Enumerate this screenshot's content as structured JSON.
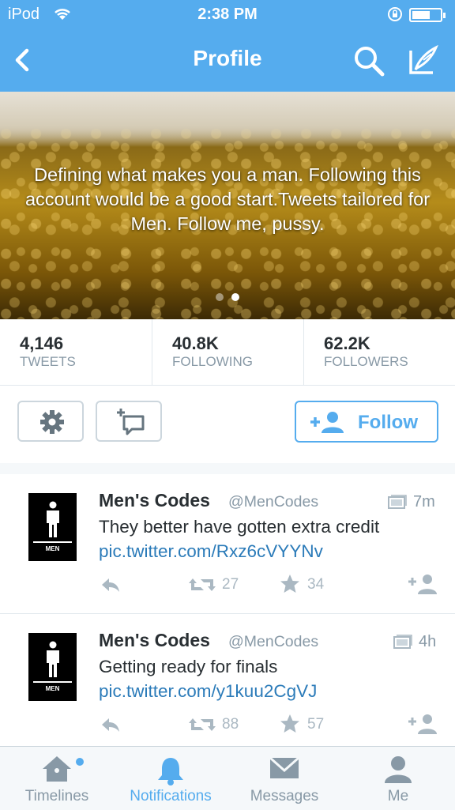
{
  "status_bar": {
    "carrier": "iPod",
    "time": "2:38 PM"
  },
  "nav": {
    "title": "Profile",
    "back_icon": "chevron-left-icon",
    "search_icon": "search-icon",
    "compose_icon": "compose-icon"
  },
  "banner": {
    "bio": "Defining what makes you a man. Following this account would be a good start.Tweets tailored for Men. Follow me, pussy.",
    "page_count": 2,
    "active_page": 2
  },
  "stats": [
    {
      "value": "4,146",
      "label": "TWEETS"
    },
    {
      "value": "40.8K",
      "label": "FOLLOWING"
    },
    {
      "value": "62.2K",
      "label": "FOLLOWERS"
    }
  ],
  "actions": {
    "settings_icon": "gear-icon",
    "list_icon": "add-to-list-icon",
    "follow_label": "Follow"
  },
  "tweets": [
    {
      "name": "Men's Codes",
      "handle": "@MenCodes",
      "time": "7m",
      "text": "They better have gotten extra credit",
      "link": "pic.twitter.com/Rxz6cVYYNv",
      "retweets": "27",
      "favorites": "34",
      "avatar_label": "MEN"
    },
    {
      "name": "Men's Codes",
      "handle": "@MenCodes",
      "time": "4h",
      "text": "Getting ready for finals",
      "link": "pic.twitter.com/y1kuu2CgVJ",
      "retweets": "88",
      "favorites": "57",
      "avatar_label": "MEN"
    }
  ],
  "tabbar": [
    {
      "label": "Timelines",
      "icon": "home-icon"
    },
    {
      "label": "Notifications",
      "icon": "bell-icon",
      "active": true
    },
    {
      "label": "Messages",
      "icon": "envelope-icon"
    },
    {
      "label": "Me",
      "icon": "person-icon"
    }
  ],
  "colors": {
    "brand": "#55acee",
    "link": "#2b7bb9",
    "muted": "#8899a6"
  }
}
